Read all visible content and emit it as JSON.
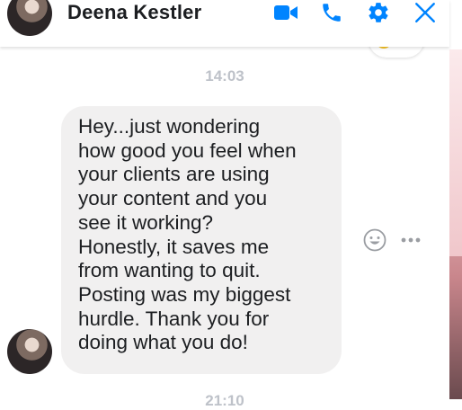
{
  "header": {
    "contact_name": "Deena Kestler",
    "icons": [
      "video-call-icon",
      "phone-icon",
      "settings-gear-icon",
      "close-icon"
    ]
  },
  "conversation": {
    "timestamp_top": "14:03",
    "timestamp_bottom": "21:10",
    "message": {
      "lines": [
        "Hey...just wondering",
        "how good you feel when",
        "your clients are using",
        "your content and you",
        "see it working?",
        "Honestly, it saves me",
        "from wanting to quit.",
        "Posting was my biggest",
        "hurdle. Thank you for",
        "doing what you do!"
      ]
    },
    "actions": [
      "reaction-icon",
      "more-options-icon"
    ]
  },
  "colors": {
    "accent": "#0084ff",
    "bubble_bg": "#f1f0f0",
    "timestamp": "#bec2c9",
    "text": "#1c1e21"
  }
}
